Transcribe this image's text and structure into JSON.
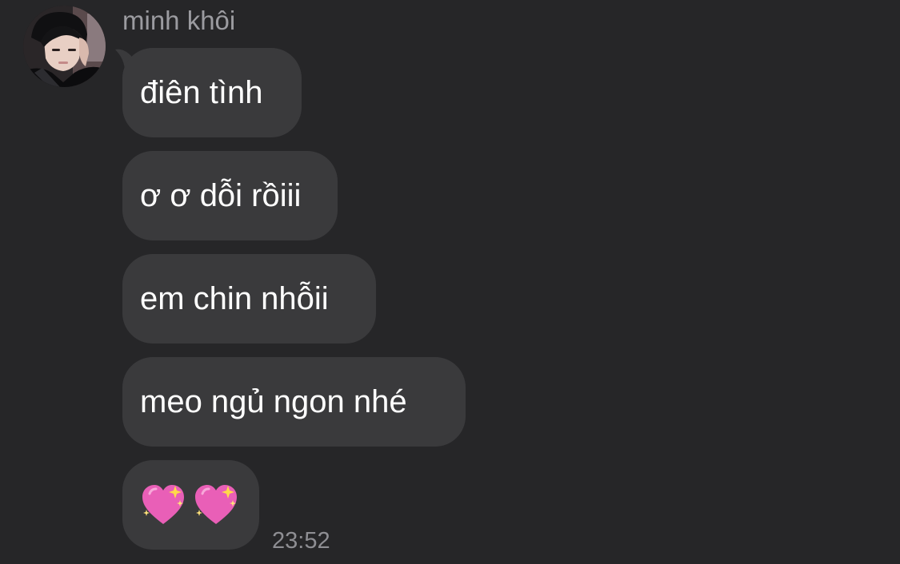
{
  "chat": {
    "sender_name": "minh khôi",
    "avatar_icon": "user-photo-avatar",
    "messages": [
      {
        "text": "điên tình"
      },
      {
        "text": "ơ ơ dỗi rồiii"
      },
      {
        "text": "em chin nhỗii"
      },
      {
        "text": "meo ngủ ngon nhé"
      },
      {
        "emoji": [
          "sparkling-heart-icon",
          "sparkling-heart-icon"
        ]
      }
    ],
    "timestamp": "23:52"
  },
  "colors": {
    "background": "#262628",
    "bubble": "#3a3a3c",
    "sender_name": "#9b9ba0",
    "timestamp": "#8e8e93",
    "heart": "#e95fb7"
  }
}
